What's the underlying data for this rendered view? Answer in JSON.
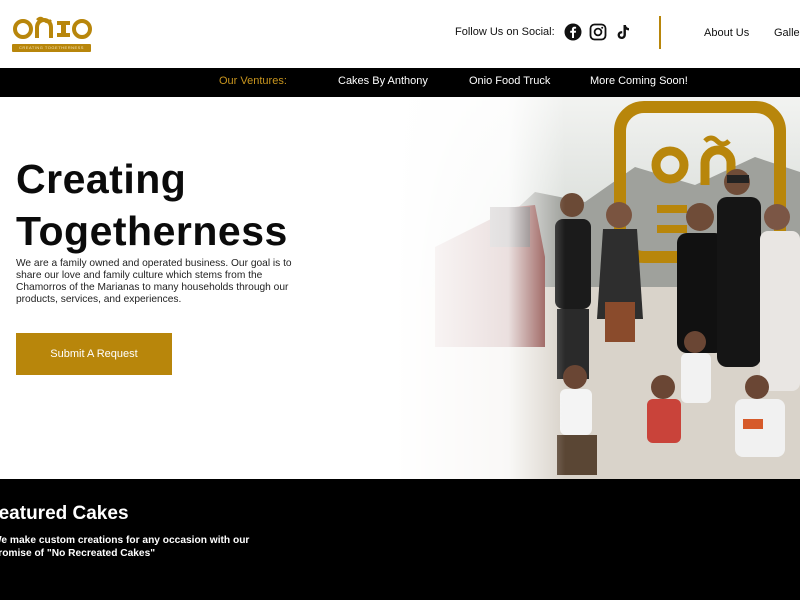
{
  "brand": {
    "logo_tagline": "CREATING TOGETHERNESS",
    "accent_color": "#b8860b"
  },
  "header": {
    "follow_label": "Follow Us on Social:",
    "social_icons": [
      "facebook-icon",
      "instagram-icon",
      "tiktok-icon"
    ],
    "nav": [
      "About Us",
      "Gallery"
    ]
  },
  "ventures_bar": {
    "label": "Our Ventures:",
    "items": [
      "Cakes By Anthony",
      "Onio Food Truck",
      "More Coming Soon!"
    ]
  },
  "hero": {
    "title_line1": "Creating",
    "title_line2": "Togetherness",
    "description": "We are a family owned and operated business. Our goal is to share our love and family culture which stems from the Chamorros of the Marianas to many households through our products, services, and experiences.",
    "cta_label": "Submit A Request"
  },
  "featured": {
    "title": "Featured Cakes",
    "description": "We make custom creations for any occasion with our promise of \"No Recreated Cakes\""
  }
}
